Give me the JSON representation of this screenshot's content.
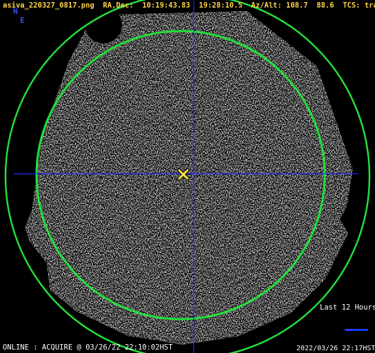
{
  "header": {
    "filename": "asiva_220327_0817.png",
    "radec_label": "RA,Dec:",
    "ra": "10:19:43.83",
    "dec": "19:28:10.5",
    "azalt_label": "Az/Alt:",
    "az": "108.7",
    "alt": "88.6",
    "tcs_label": "TCS:",
    "tcs": "track"
  },
  "directions": {
    "north": "N",
    "east": "E"
  },
  "legend": {
    "label": "Last 12 Hours"
  },
  "footer": {
    "status": "ONLINE : ACQUIRE @ 03/26/22 22:10:02HST",
    "timestamp": "2022/03/26 22:17HST"
  },
  "colors": {
    "header_text": "#ffd34a",
    "circle": "#22e03a",
    "crosshair": "#1e2cff",
    "target_marker": "#ffe34a",
    "track_line": "#1a3cff"
  },
  "icons": {
    "target": "target-x-marker-icon"
  }
}
